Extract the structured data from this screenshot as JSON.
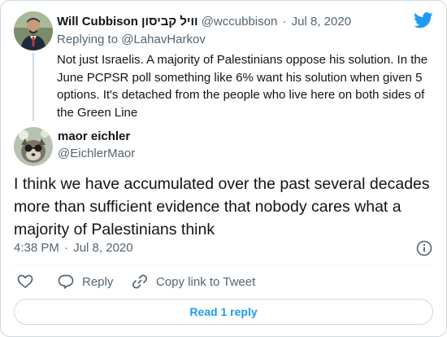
{
  "parent_tweet": {
    "author_name": "Will Cubbison וויל קביסון",
    "handle": "@wccubbison",
    "separator": "·",
    "date": "Jul 8, 2020",
    "replying_to_prefix": "Replying to",
    "replying_to_handle": "@LahavHarkov",
    "text": "Not just Israelis. A majority of Palestinians oppose his solution. In the June PCPSR poll something like 6% want his solution when given 5 options. It's detached from the people who live here on both sides of the Green Line"
  },
  "main_tweet": {
    "author_name": "maor eichler",
    "handle": "@EichlerMaor",
    "text": "I think we have accumulated over the past several decades more than sufficient evidence that nobody cares what a majority of Palestinians think",
    "time": "4:38 PM",
    "separator": "·",
    "date": "Jul 8, 2020"
  },
  "actions": {
    "reply_label": "Reply",
    "copy_link_label": "Copy link to Tweet"
  },
  "read_replies_label": "Read 1 reply",
  "icons": {
    "brand": "twitter-bird-icon",
    "like": "heart-icon",
    "reply": "speech-bubble-icon",
    "copy": "link-icon",
    "info": "info-icon"
  },
  "colors": {
    "brand_blue": "#1d9bf0",
    "muted_text": "#536471",
    "border": "#cfd9de"
  }
}
